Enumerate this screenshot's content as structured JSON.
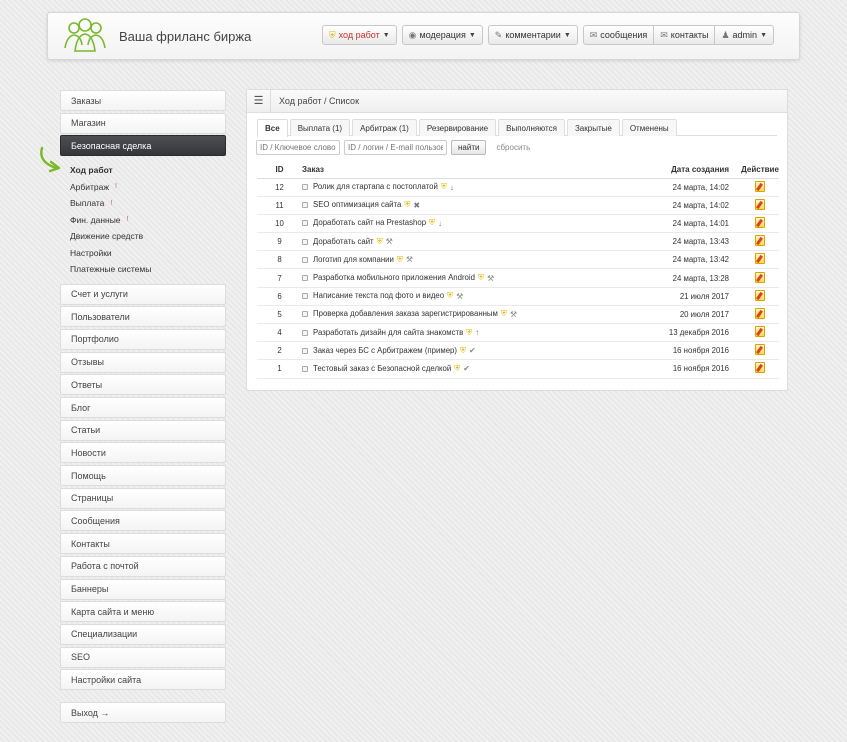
{
  "header": {
    "site_title": "Ваша фриланс биржа",
    "nav": [
      {
        "label": "ход работ",
        "icon": "shield-icon",
        "active": true,
        "caret": true
      },
      {
        "label": "модерация",
        "icon": "eye-icon",
        "active": false,
        "caret": true
      },
      {
        "label": "комментарии",
        "icon": "pencil-icon",
        "active": false,
        "caret": true
      }
    ],
    "nav_group": [
      {
        "label": "сообщения",
        "icon": "envelope-icon"
      },
      {
        "label": "контакты",
        "icon": "envelope-icon"
      },
      {
        "label": "admin",
        "icon": "user-icon",
        "caret": true
      }
    ]
  },
  "sidebar": {
    "top_items": [
      "Заказы",
      "Магазин"
    ],
    "active_item": "Безопасная сделка",
    "sub_items": [
      {
        "label": "Ход работ",
        "current": true,
        "mark": ""
      },
      {
        "label": "Арбитраж",
        "current": false,
        "mark": "!"
      },
      {
        "label": "Выплата",
        "current": false,
        "mark": "!"
      },
      {
        "label": "Фин. данные",
        "current": false,
        "mark": "!"
      },
      {
        "label": "Движение средств",
        "current": false,
        "mark": ""
      },
      {
        "label": "Настройки",
        "current": false,
        "mark": ""
      },
      {
        "label": "Платежные системы",
        "current": false,
        "mark": ""
      }
    ],
    "items": [
      "Счет и услуги",
      "Пользователи",
      "Портфолио",
      "Отзывы",
      "Ответы",
      "Блог",
      "Статьи",
      "Новости",
      "Помощь",
      "Страницы",
      "Сообщения",
      "Контакты",
      "Работа с почтой",
      "Баннеры",
      "Карта сайта и меню",
      "Специализации",
      "SEO",
      "Настройки сайта"
    ],
    "logout": "Выход →",
    "accent_color": "#7ab929"
  },
  "panel": {
    "breadcrumb": "Ход работ / Список",
    "tabs": [
      {
        "label": "Все",
        "active": true
      },
      {
        "label": "Выплата (1)",
        "active": false
      },
      {
        "label": "Арбитраж (1)",
        "active": false
      },
      {
        "label": "Резервирование",
        "active": false
      },
      {
        "label": "Выполняются",
        "active": false
      },
      {
        "label": "Закрытые",
        "active": false
      },
      {
        "label": "Отменены",
        "active": false
      }
    ],
    "filters": {
      "keyword_placeholder": "ID / Ключевое слово",
      "user_placeholder": "ID / логин / E-mail пользов",
      "find_label": "найти",
      "reset_label": "сбросить"
    },
    "columns": {
      "id": "ID",
      "order": "Заказ",
      "created": "Дата создания",
      "action": "Действие"
    },
    "rows": [
      {
        "id": "12",
        "title": "Ролик для стартапа с постоплатой",
        "status": "down-icon",
        "date": "24 марта, 14:02"
      },
      {
        "id": "11",
        "title": "SEO оптимизация сайта",
        "status": "cross-icon",
        "date": "24 марта, 14:02"
      },
      {
        "id": "10",
        "title": "Доработать сайт на Prestashop",
        "status": "down-icon",
        "date": "24 марта, 14:01"
      },
      {
        "id": "9",
        "title": "Доработать сайт",
        "status": "wrench-icon",
        "date": "24 марта, 13:43"
      },
      {
        "id": "8",
        "title": "Логотип для компании",
        "status": "wrench-icon",
        "date": "24 марта, 13:42"
      },
      {
        "id": "7",
        "title": "Разработка мобильного приложения Android",
        "status": "wrench-icon",
        "date": "24 марта, 13:28"
      },
      {
        "id": "6",
        "title": "Написание текста под фото и видео",
        "status": "wrench-icon",
        "date": "21 июля 2017"
      },
      {
        "id": "5",
        "title": "Проверка добавления заказа зарегистрированным",
        "status": "wrench-icon",
        "date": "20 июля 2017"
      },
      {
        "id": "4",
        "title": "Разработать дизайн для сайта знакомств",
        "status": "up-icon",
        "date": "13 декабря 2016"
      },
      {
        "id": "2",
        "title": "Заказ через БС с Арбитражем (пример)",
        "status": "check-icon",
        "date": "16 ноября 2016"
      },
      {
        "id": "1",
        "title": "Тестовый заказ с Безопасной сделкой",
        "status": "check-icon",
        "date": "16 ноября 2016"
      }
    ]
  }
}
